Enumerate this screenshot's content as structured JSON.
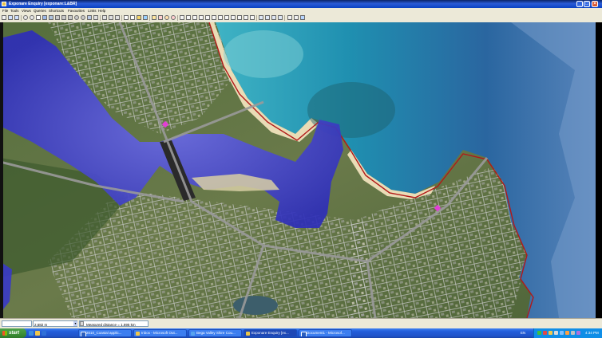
{
  "window": {
    "title": "Exponare Enquiry [exponare:L&BR]",
    "buttons": {
      "minimize": "_",
      "maximize": "□",
      "close": "×"
    }
  },
  "menu": [
    "File",
    "Tools",
    "Views",
    "Queries",
    "Shortcuts",
    "Favourites",
    "Links",
    "Help"
  ],
  "status": {
    "scale_value": "2,682 m",
    "measured_distance": "Measured distance = 1.695 km"
  },
  "taskbar": {
    "start_label": "start",
    "tasks": [
      {
        "label": "2010_Coastal applic...",
        "icon": "word-icon"
      },
      {
        "label": "Inbox - Microsoft Out...",
        "icon": "outlook-icon"
      },
      {
        "label": "Bega Valley Shire Cou...",
        "icon": "ie-icon"
      },
      {
        "label": "Exponare Enquiry [ex...",
        "icon": "exponare-icon"
      },
      {
        "label": "Document1 - Microsof...",
        "icon": "word-icon"
      }
    ],
    "language": "EN",
    "clock": "4:34 PM"
  },
  "colors": {
    "taskbar": "#245edb",
    "start": "#3c8f36",
    "water_overlay": "#3c3cd2",
    "ocean": "#2f6fa8",
    "lagoon": "#3aa7b5",
    "cadastre_lines": "#b9b9b9",
    "coastal_line": "#b21818",
    "marker": "#e23fd6"
  }
}
